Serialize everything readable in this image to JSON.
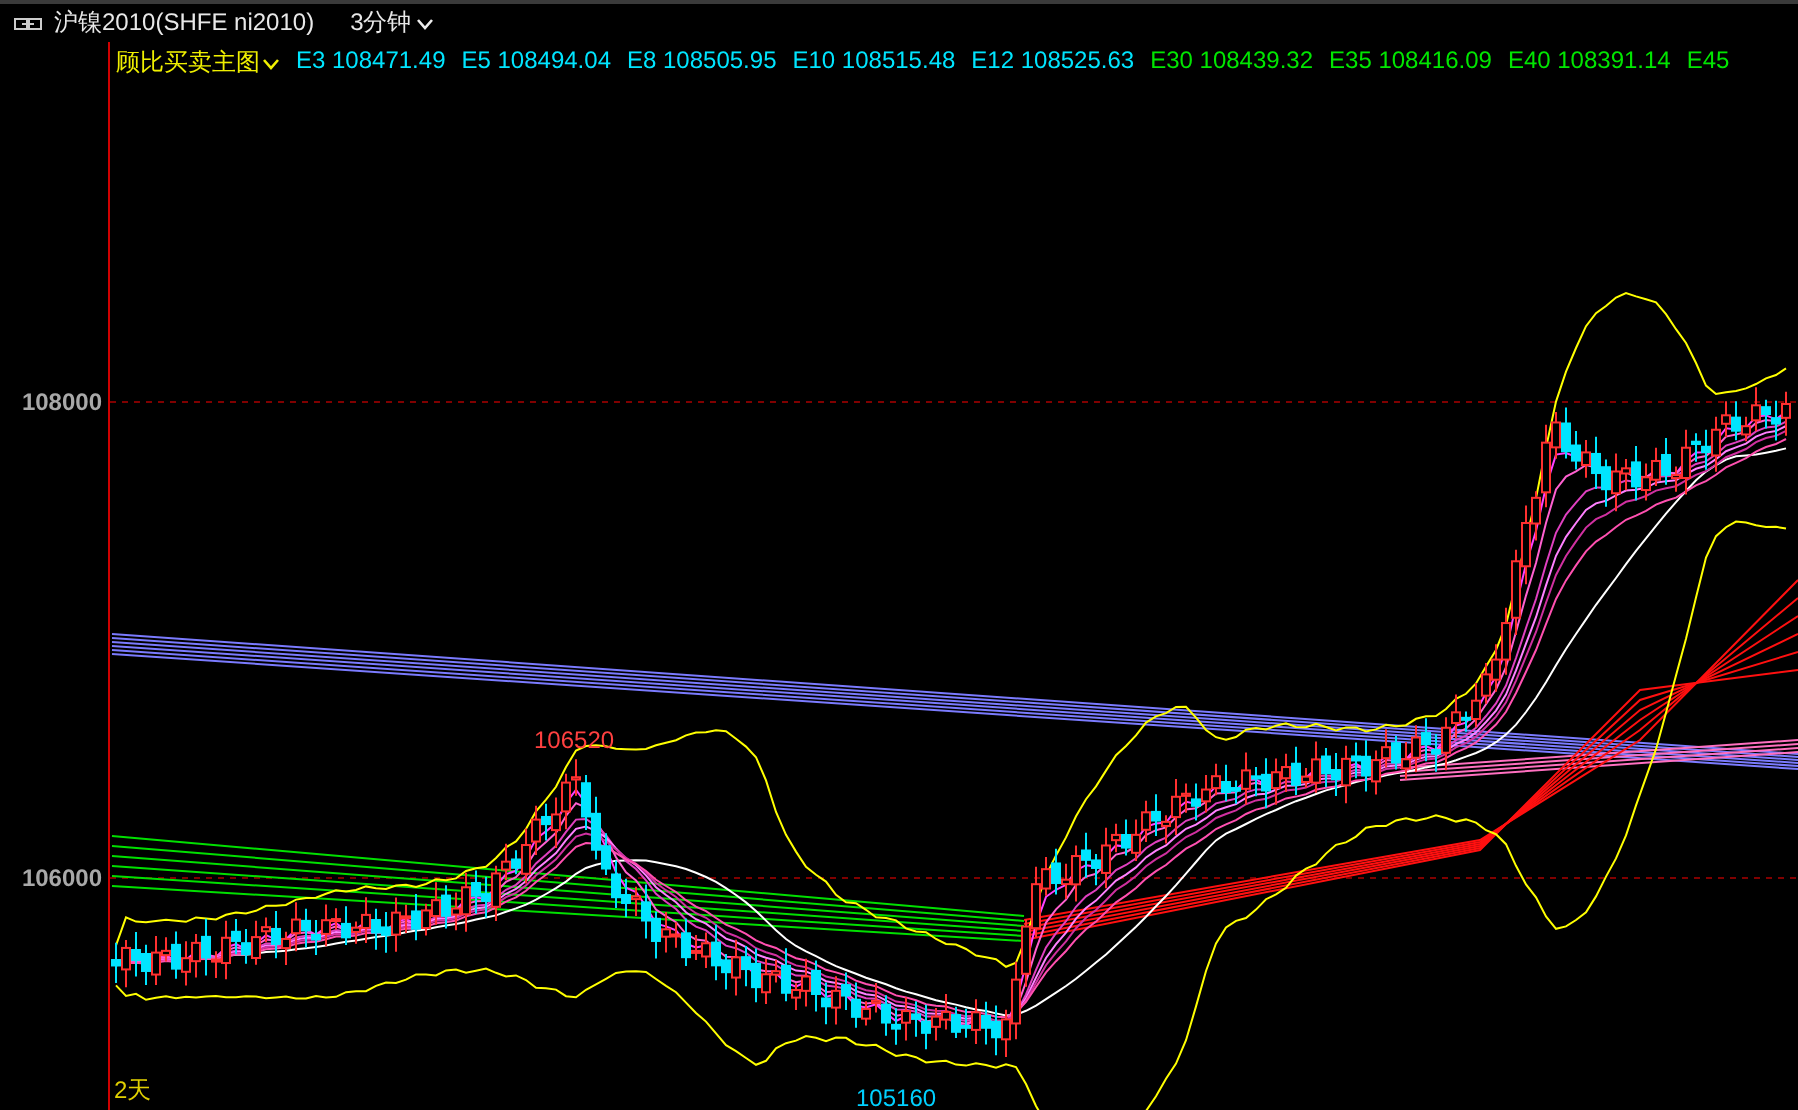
{
  "title_bar": {
    "symbol": "沪镍2010(SHFE ni2010)",
    "period": "3分钟"
  },
  "indicator": {
    "name": "顾比买卖主图"
  },
  "legend": [
    {
      "name": "E3",
      "value": "108471.49",
      "color": "#00e5ff"
    },
    {
      "name": "E5",
      "value": "108494.04",
      "color": "#00e5ff"
    },
    {
      "name": "E8",
      "value": "108505.95",
      "color": "#00e5ff"
    },
    {
      "name": "E10",
      "value": "108515.48",
      "color": "#00e5ff"
    },
    {
      "name": "E12",
      "value": "108525.63",
      "color": "#00e5ff"
    },
    {
      "name": "E30",
      "value": "108439.32",
      "color": "#00e600"
    },
    {
      "name": "E35",
      "value": "108416.09",
      "color": "#00e600"
    },
    {
      "name": "E40",
      "value": "108391.14",
      "color": "#00e600"
    },
    {
      "name": "E45",
      "color": "#00e600"
    }
  ],
  "y_axis": [
    {
      "label": "108000"
    },
    {
      "label": "106000"
    }
  ],
  "annotations": {
    "high": "106520",
    "low": "105160",
    "range": "2天"
  }
}
